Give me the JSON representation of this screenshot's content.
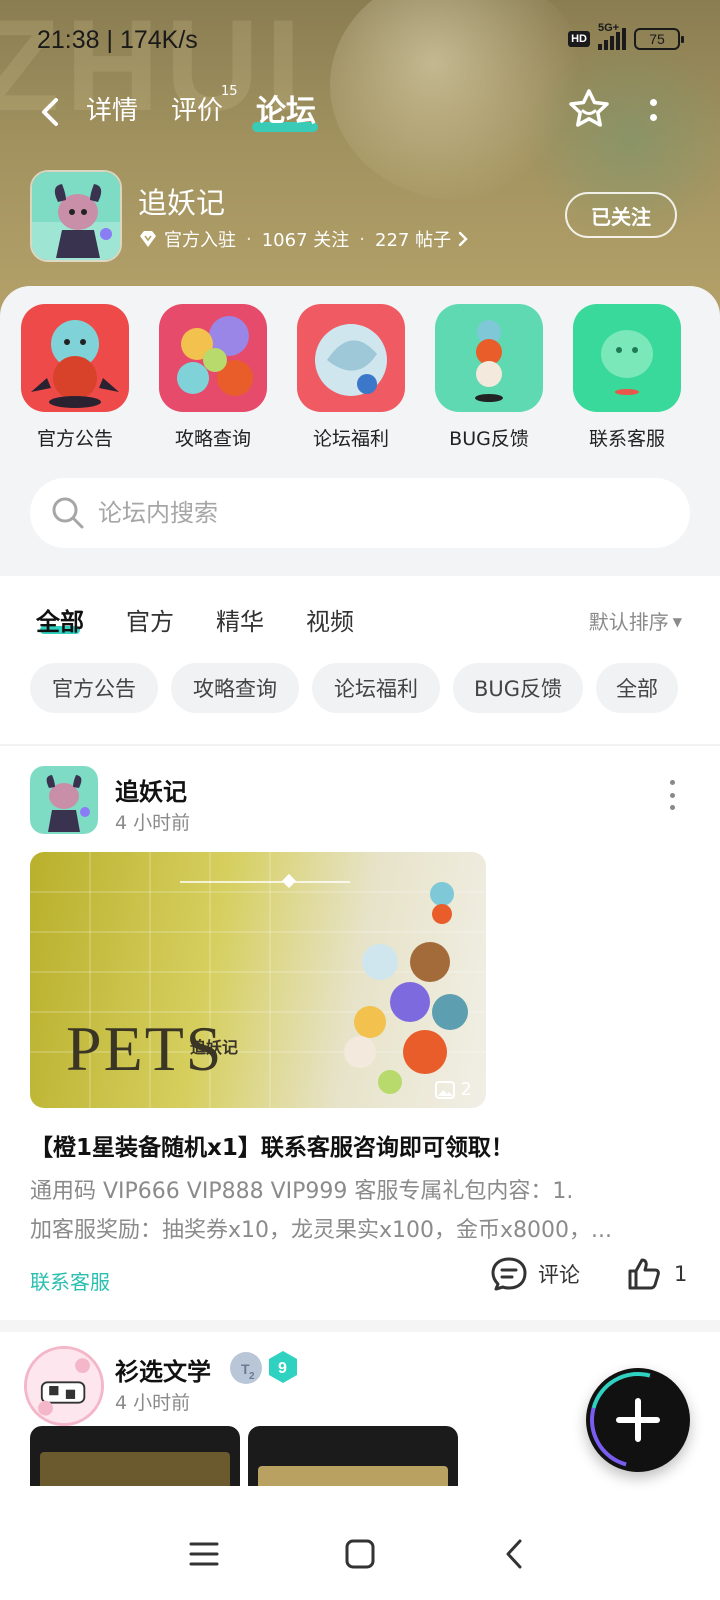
{
  "status_bar": {
    "time": "21:38 | 174K/s",
    "hd": "HD",
    "network": "5G+",
    "battery": "75"
  },
  "top_nav": {
    "tabs": [
      {
        "label": "详情"
      },
      {
        "label": "评价",
        "badge": "15"
      },
      {
        "label": "论坛"
      }
    ],
    "active_tab": "论坛"
  },
  "game": {
    "name": "追妖记",
    "official": "官方入驻",
    "follows": "1067 关注",
    "posts": "227 帖子",
    "follow_label": "已关注"
  },
  "shortcuts": [
    {
      "label": "官方公告"
    },
    {
      "label": "攻略查询"
    },
    {
      "label": "论坛福利"
    },
    {
      "label": "BUG反馈"
    },
    {
      "label": "联系客服"
    }
  ],
  "search": {
    "placeholder": "论坛内搜索"
  },
  "filter_tabs": [
    {
      "label": "全部"
    },
    {
      "label": "官方"
    },
    {
      "label": "精华"
    },
    {
      "label": "视频"
    }
  ],
  "sort_label": "默认排序",
  "chips": [
    {
      "label": "官方公告"
    },
    {
      "label": "攻略查询"
    },
    {
      "label": "论坛福利"
    },
    {
      "label": "BUG反馈"
    },
    {
      "label": "全部"
    }
  ],
  "posts": [
    {
      "author": "追妖记",
      "time": "4 小时前",
      "image_text": "PETS",
      "image_text_cn": "追妖记",
      "image_count": "2",
      "title": "【橙1星装备随机x1】联系客服咨询即可领取！",
      "body_line1": "通用码 VIP666 VIP888 VIP999 客服专属礼包内容：1.",
      "body_line2": "加客服奖励：抽奖券x10，龙灵果实x100，金币x8000，...",
      "tag": "联系客服",
      "comment_label": "评论",
      "likes": "1"
    },
    {
      "author": "衫选文学",
      "time": "4 小时前",
      "badge_level": "9",
      "badge_sub": "2"
    }
  ],
  "colors": {
    "accent": "#2fd1c1",
    "banner": "#a1925f",
    "panel": "#f3f4f6"
  }
}
